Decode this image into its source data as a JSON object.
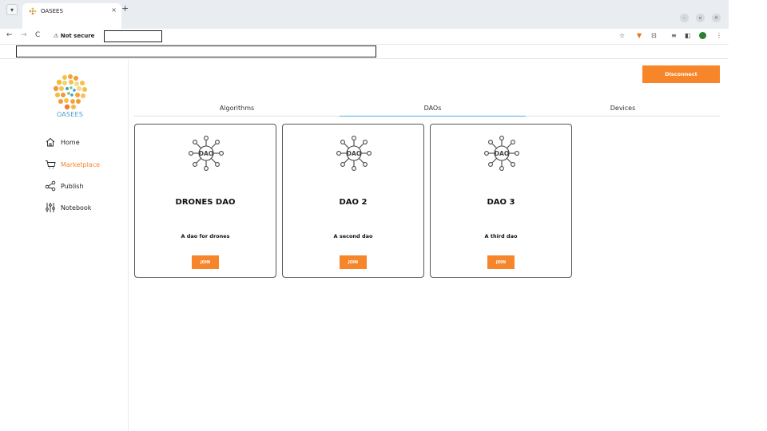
{
  "browser": {
    "tab_title": "OASEES",
    "new_tab": "+",
    "tab_close": "×",
    "not_secure": "⚠ Not secure",
    "back": "←",
    "forward": "→",
    "reload": "C"
  },
  "sidebar": {
    "logo_text": "OASEES",
    "items": [
      {
        "label": "Home",
        "icon": "home-icon"
      },
      {
        "label": "Marketplace",
        "icon": "cart-icon",
        "active": true
      },
      {
        "label": "Publish",
        "icon": "share-icon"
      },
      {
        "label": "Notebook",
        "icon": "sliders-icon"
      }
    ]
  },
  "header": {
    "disconnect_label": "Disconnect"
  },
  "tabs": [
    {
      "label": "Algorithms"
    },
    {
      "label": "DAOs",
      "active": true
    },
    {
      "label": "Devices"
    }
  ],
  "cards": [
    {
      "title": "DRONES DAO",
      "description": "A dao for drones",
      "button": "JOIN",
      "icon_text": "DAO"
    },
    {
      "title": "DAO 2",
      "description": "A second dao",
      "button": "JOIN",
      "icon_text": "DAO"
    },
    {
      "title": "DAO 3",
      "description": "A third dao",
      "button": "JOIN",
      "icon_text": "DAO"
    }
  ],
  "colors": {
    "accent": "#f7862b",
    "brand": "#4fa0c8",
    "tab_indicator": "#4fb3d9"
  }
}
